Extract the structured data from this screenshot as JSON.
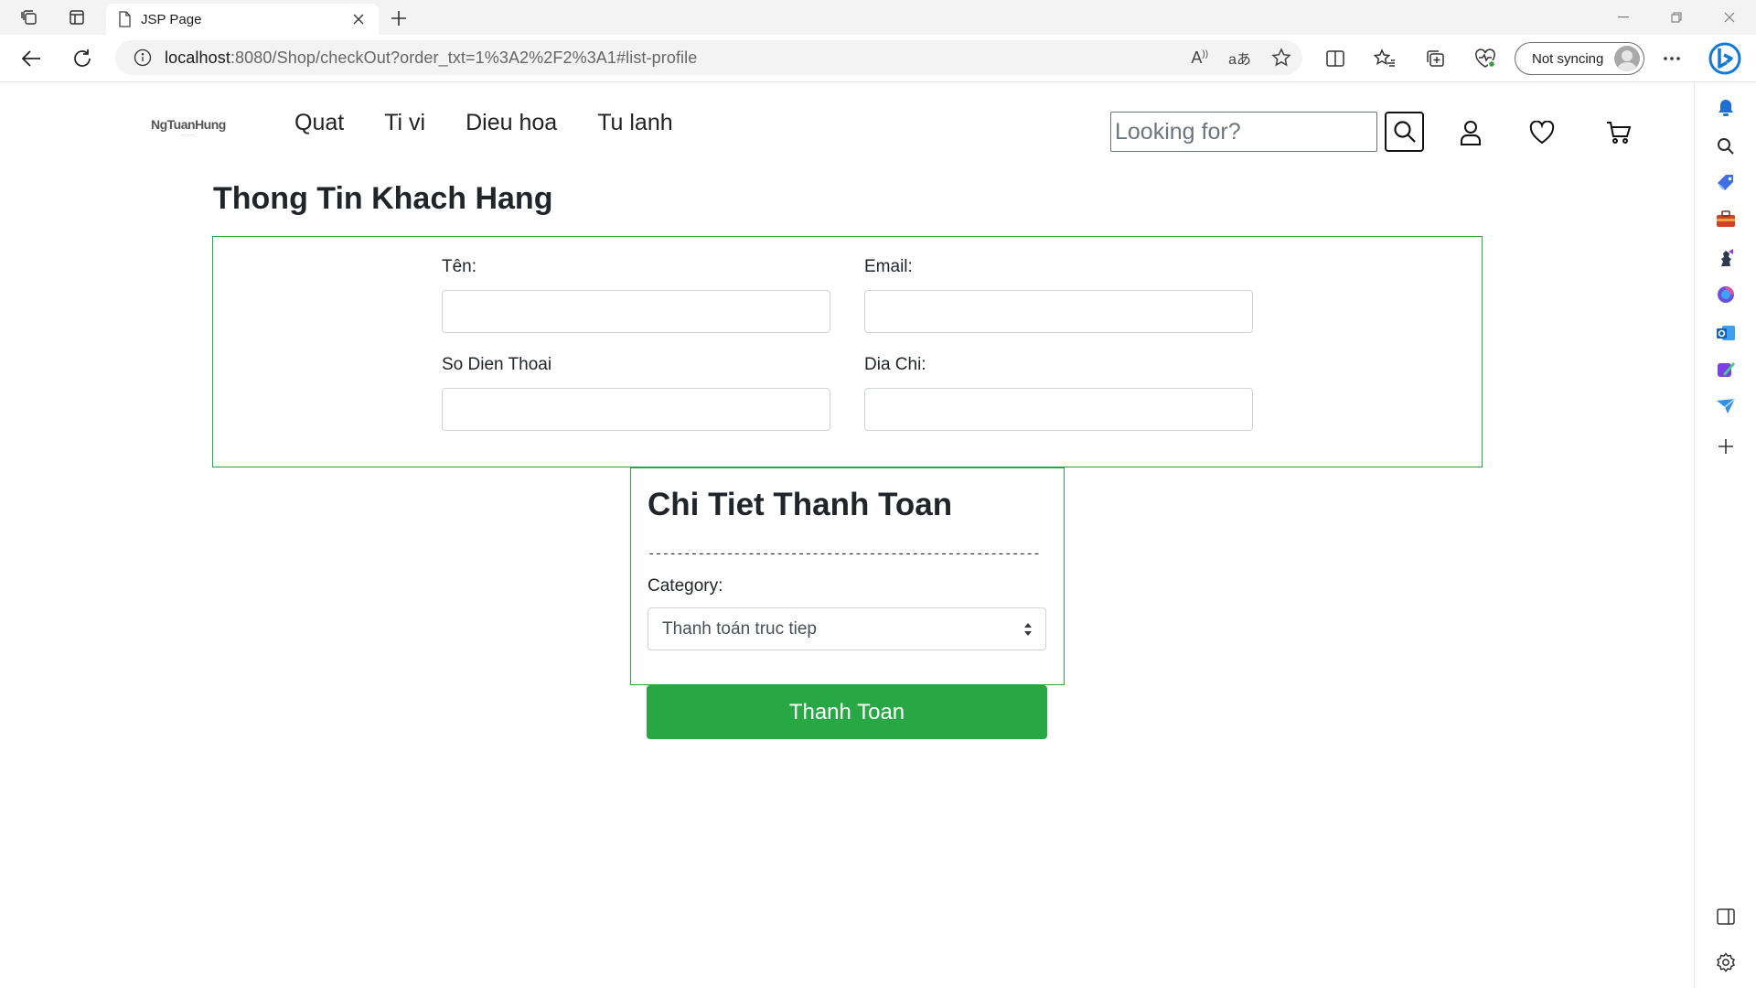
{
  "browser": {
    "tab_title": "JSP Page",
    "url_host": "localhost",
    "url_rest": ":8080/Shop/checkOut?order_txt=1%3A2%2F2%3A1#list-profile",
    "sync_label": "Not syncing"
  },
  "site": {
    "logo_text": "NgTuanHung",
    "menu": [
      "Quat",
      "Ti vi",
      "Dieu hoa",
      "Tu lanh"
    ],
    "search_placeholder": "Looking for?"
  },
  "customer": {
    "title": "Thong Tin Khach Hang",
    "name_label": "Tên:",
    "email_label": "Email:",
    "phone_label": "So Dien Thoai",
    "address_label": "Dia Chi:"
  },
  "payment": {
    "title": "Chi Tiet Thanh Toan",
    "divider": "-------------------------------------------------------",
    "category_label": "Category:",
    "selected_option": "Thanh toán truc tiep",
    "submit_label": "Thanh Toan"
  },
  "colors": {
    "accent_green": "#28a745",
    "bing_blue": "#1479d6"
  }
}
